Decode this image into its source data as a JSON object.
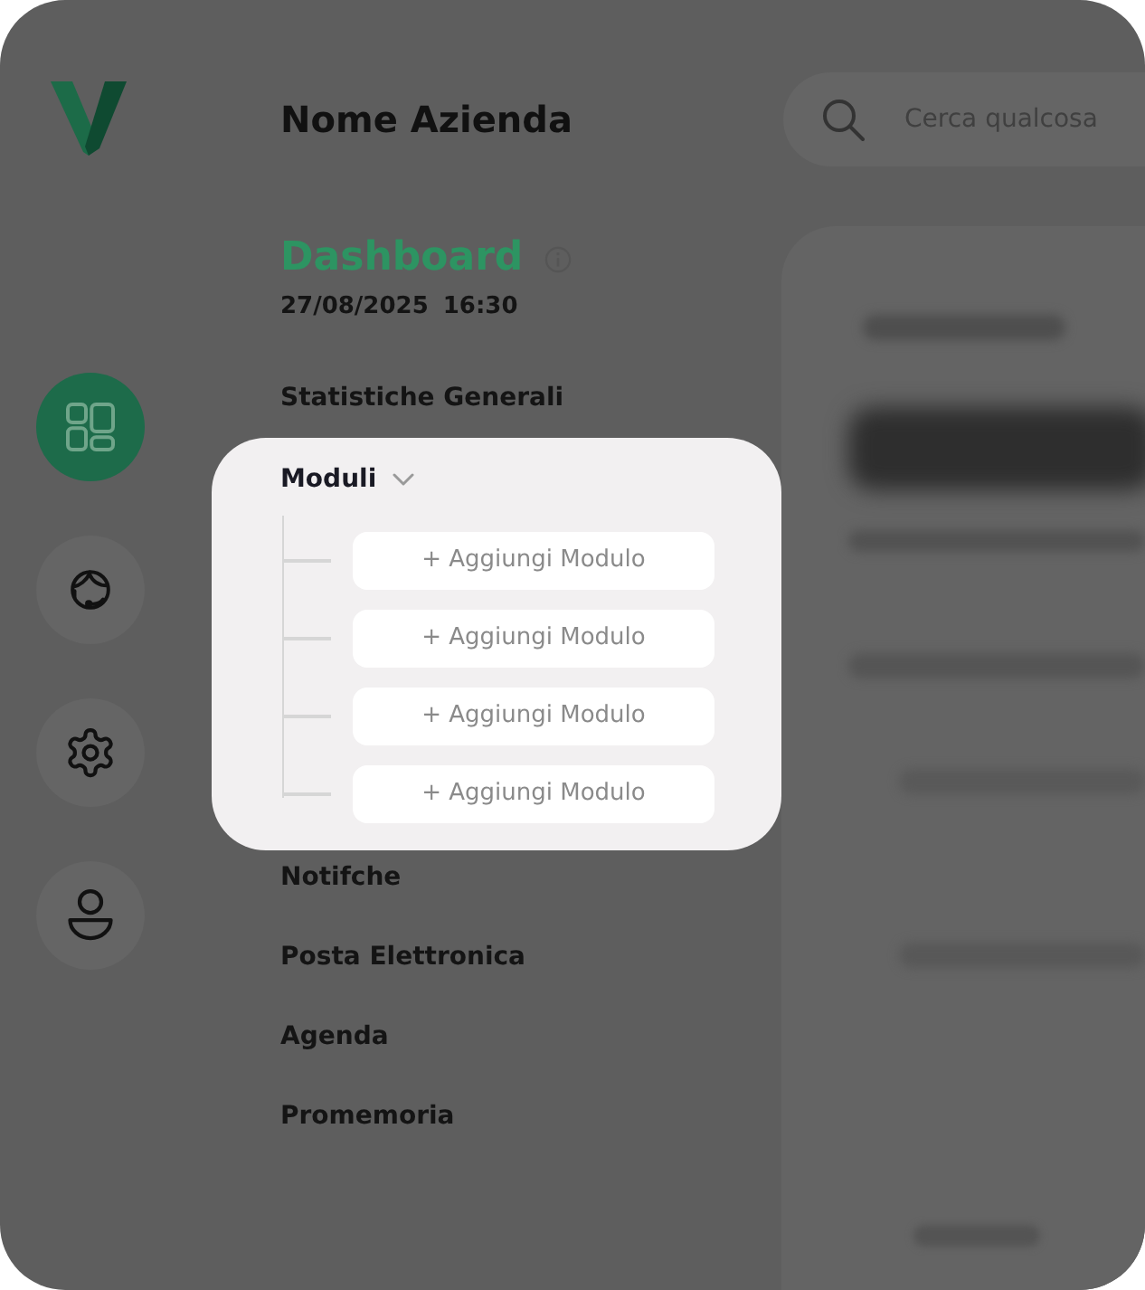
{
  "sidebar": {
    "items": [
      {
        "kind": "dashboard",
        "selected": true
      },
      {
        "kind": "support",
        "selected": false
      },
      {
        "kind": "settings",
        "selected": false
      },
      {
        "kind": "profile",
        "selected": false
      }
    ]
  },
  "header": {
    "company_name": "Nome Azienda",
    "search": {
      "placeholder": "Cerca qualcosa"
    }
  },
  "nav": {
    "title": "Dashboard",
    "date": "27/08/2025",
    "time": "16:30",
    "items": [
      {
        "kind": "link",
        "label": "Statistiche Generali",
        "highlighted": false
      },
      {
        "kind": "group",
        "label": "Moduli",
        "highlighted": true,
        "expanded": true,
        "children": [
          {
            "label": "+ Aggiungi Modulo"
          },
          {
            "label": "+ Aggiungi Modulo"
          },
          {
            "label": "+ Aggiungi Modulo"
          },
          {
            "label": "+ Aggiungi Modulo"
          }
        ]
      },
      {
        "kind": "link",
        "label": "Notifche",
        "highlighted": false
      },
      {
        "kind": "link",
        "label": "Posta Elettronica",
        "highlighted": false
      },
      {
        "kind": "link",
        "label": "Agenda",
        "highlighted": false
      },
      {
        "kind": "link",
        "label": "Promemoria",
        "highlighted": false
      }
    ]
  }
}
